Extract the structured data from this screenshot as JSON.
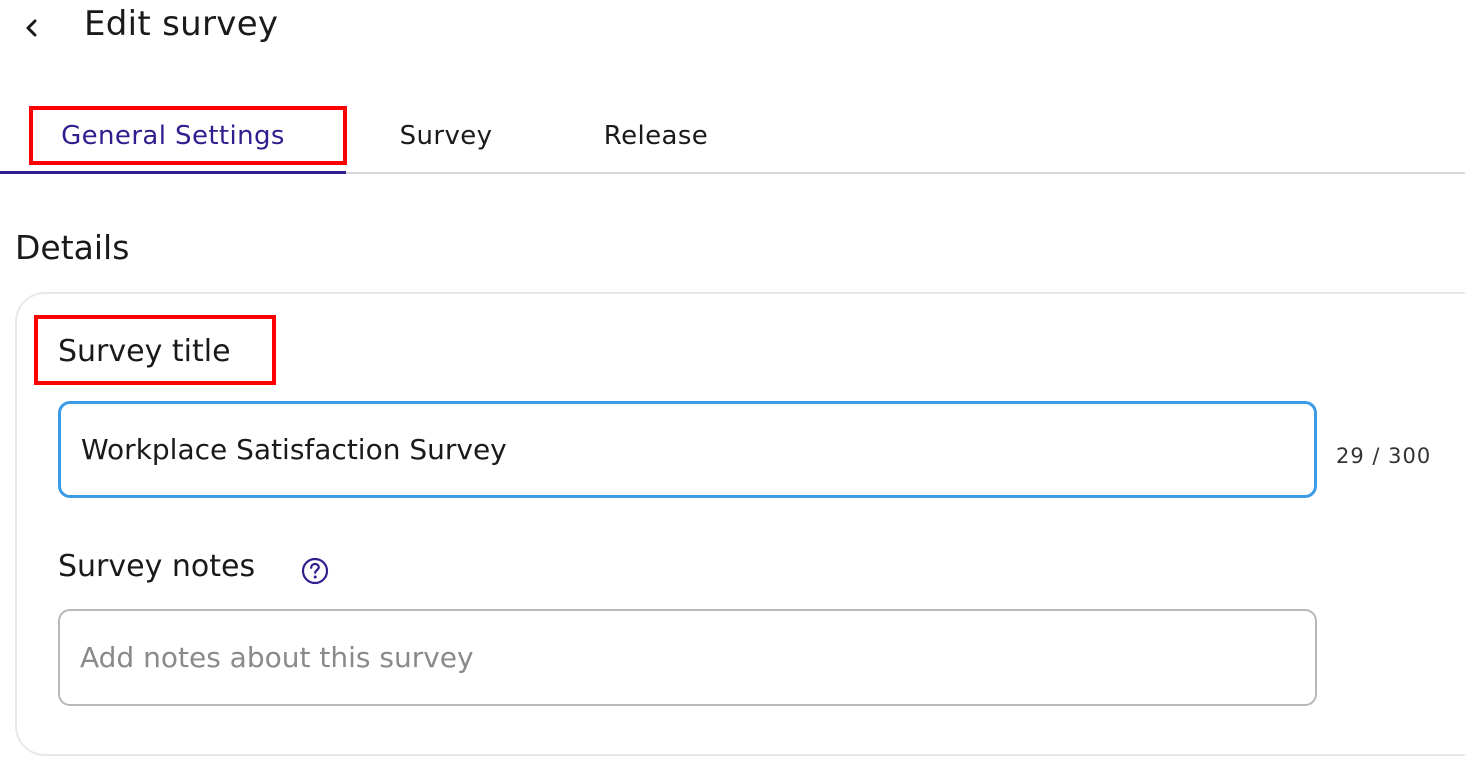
{
  "header": {
    "title": "Edit survey",
    "back_icon": "chevron-left-icon"
  },
  "tabs": [
    {
      "label": "General Settings",
      "active": true
    },
    {
      "label": "Survey",
      "active": false
    },
    {
      "label": "Release",
      "active": false
    }
  ],
  "details": {
    "heading": "Details",
    "survey_title": {
      "label": "Survey title",
      "value": "Workplace Satisfaction Survey",
      "char_count": "29 / 300"
    },
    "survey_notes": {
      "label": "Survey notes",
      "placeholder": "Add notes about this survey",
      "help_icon": "help-circle-icon"
    }
  },
  "colors": {
    "accent": "#2e1f8f",
    "focus_border": "#3a9be6",
    "highlight": "#ff0000"
  }
}
